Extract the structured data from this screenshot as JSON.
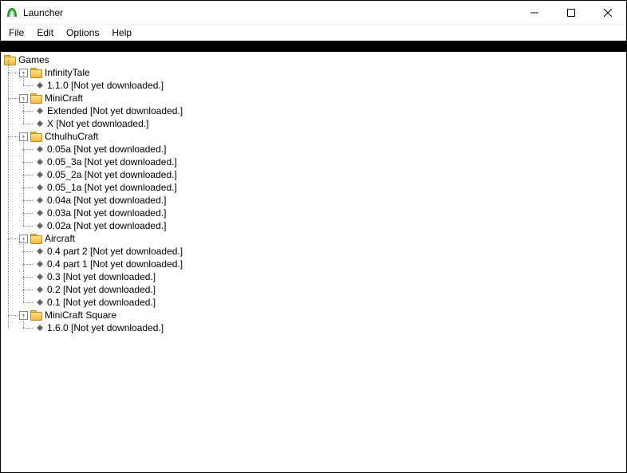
{
  "window": {
    "title": "Launcher"
  },
  "menu": {
    "items": [
      "File",
      "Edit",
      "Options",
      "Help"
    ]
  },
  "tree": {
    "root_label": "Games",
    "status_not_downloaded": "[Not yet downloaded.]",
    "games": [
      {
        "name": "InfinityTale",
        "versions": [
          "1.1.0"
        ]
      },
      {
        "name": "MiniCraft",
        "versions": [
          "Extended",
          "X"
        ]
      },
      {
        "name": "CthulhuCraft",
        "versions": [
          "0.05a",
          "0.05_3a",
          "0.05_2a",
          "0.05_1a",
          "0.04a",
          "0.03a",
          "0.02a"
        ]
      },
      {
        "name": "Aircraft",
        "versions": [
          "0.4 part 2",
          "0.4 part 1",
          "0.3",
          "0.2",
          "0.1"
        ]
      },
      {
        "name": "MiniCraft Square",
        "versions": [
          "1.6.0"
        ]
      }
    ]
  }
}
